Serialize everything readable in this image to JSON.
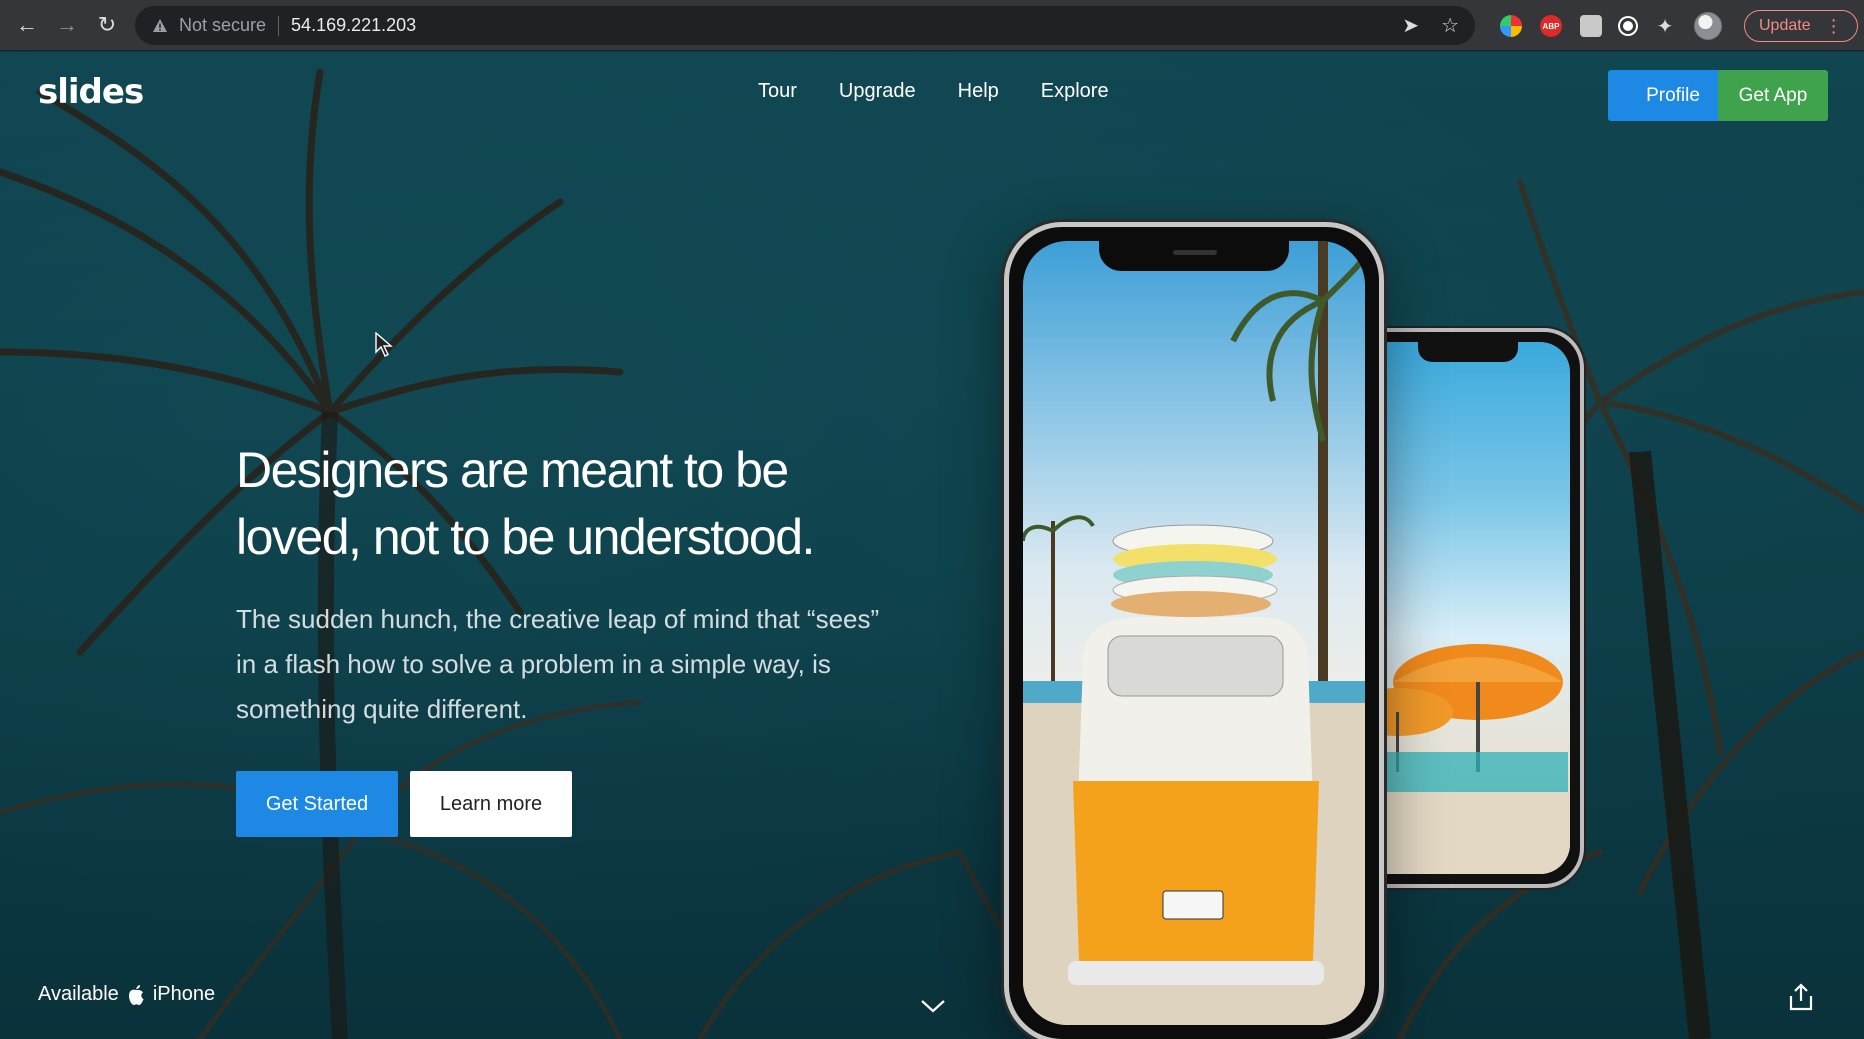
{
  "browser": {
    "security_label": "Not secure",
    "url": "54.169.221.203",
    "update_label": "Update",
    "extensions": [
      "multicolor-extension-icon",
      "adblock-icon",
      "square-extension-icon",
      "circle-extension-icon",
      "puzzle-icon",
      "profile-avatar"
    ]
  },
  "site": {
    "logo": "slides",
    "nav": [
      "Tour",
      "Upgrade",
      "Help",
      "Explore"
    ],
    "profile_label": "Profile",
    "get_app_label": "Get App"
  },
  "hero": {
    "headline_line1": "Designers are meant to be",
    "headline_line2": "loved, not to be understood.",
    "subtext_line1": "The sudden hunch, the creative leap of mind that “sees”",
    "subtext_line2": "in a flash how to solve a problem in a simple way, is",
    "subtext_line3": "something quite different.",
    "primary_button": "Get Started",
    "secondary_button": "Learn more"
  },
  "footer": {
    "available_label": "Available",
    "platform_label": "iPhone"
  },
  "colors": {
    "primary_blue": "#1e88e5",
    "green": "#3fa34d",
    "background_teal": "#0d3a44"
  }
}
